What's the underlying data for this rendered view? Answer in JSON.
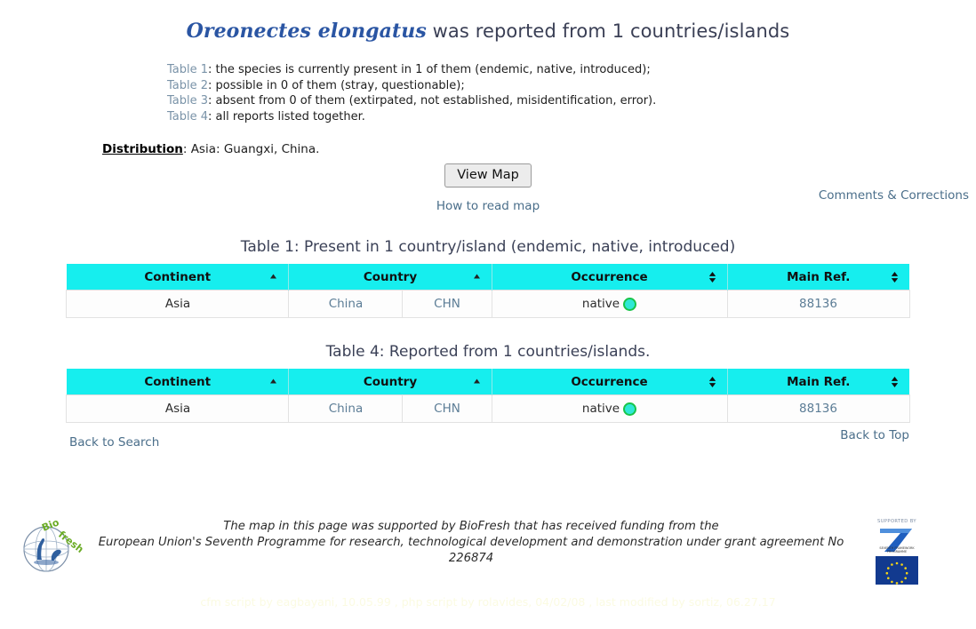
{
  "header": {
    "species_name": "Oreonectes elongatus",
    "title_rest": " was reported from 1 countries/islands"
  },
  "intro": {
    "lines": [
      {
        "label": "Table 1",
        "text": ": the species is currently present in 1 of them (endemic, native, introduced);"
      },
      {
        "label": "Table 2",
        "text": ": possible in 0 of them (stray, questionable);"
      },
      {
        "label": "Table 3",
        "text": ": absent from 0 of them (extirpated, not established, misidentification, error)."
      },
      {
        "label": "Table 4",
        "text": ": all reports listed together."
      }
    ]
  },
  "distribution": {
    "label": "Distribution",
    "value": ": Asia: Guangxi, China."
  },
  "links": {
    "comments": "Comments & Corrections",
    "how_to_read_map": "How to read map",
    "back_to_search": "Back to Search",
    "back_to_top": "Back to Top"
  },
  "buttons": {
    "view_map": "View Map"
  },
  "tables": [
    {
      "caption": "Table 1: Present in 1 country/island (endemic, native, introduced)",
      "columns": [
        {
          "label": "Continent",
          "sort": "asc"
        },
        {
          "label": "Country",
          "sort": "asc"
        },
        {
          "label": "",
          "sort": "none"
        },
        {
          "label": "Occurrence",
          "sort": "both"
        },
        {
          "label": "Main Ref.",
          "sort": "both"
        }
      ],
      "rows": [
        {
          "continent": "Asia",
          "country": "China",
          "code": "CHN",
          "occurrence": "native",
          "occurrence_status_color": "#19C44A",
          "main_ref": "88136"
        }
      ]
    },
    {
      "caption": "Table 4: Reported from 1 countries/islands.",
      "columns": [
        {
          "label": "Continent",
          "sort": "asc"
        },
        {
          "label": "Country",
          "sort": "asc"
        },
        {
          "label": "",
          "sort": "none"
        },
        {
          "label": "Occurrence",
          "sort": "both"
        },
        {
          "label": "Main Ref.",
          "sort": "both"
        }
      ],
      "rows": [
        {
          "continent": "Asia",
          "country": "China",
          "code": "CHN",
          "occurrence": "native",
          "occurrence_status_color": "#19C44A",
          "main_ref": "88136"
        }
      ]
    }
  ],
  "footer": {
    "biofresh_line1": "The map in this page was supported by BioFresh that has received funding from the",
    "biofresh_line2": "European Union's Seventh Programme for research, technological development and demonstration under grant agreement No",
    "biofresh_line3": "226874",
    "biofresh_logo_text": "BioFresh",
    "eu_supported_by": "SUPPORTED BY",
    "eu_fp7_caption": "SEVENTH FRAMEWORK PROGRAMME",
    "credits": "cfm script by eagbayani, 10.05.99 ,  php script by rolavides, 04/02/08 ,  last modified by sortiz, 06.27.17"
  },
  "theme": {
    "header_cyan": "#16EEEE",
    "link_blue": "#4a6e8a",
    "title_navy": "#3b4157",
    "species_blue": "#2a55a3"
  }
}
